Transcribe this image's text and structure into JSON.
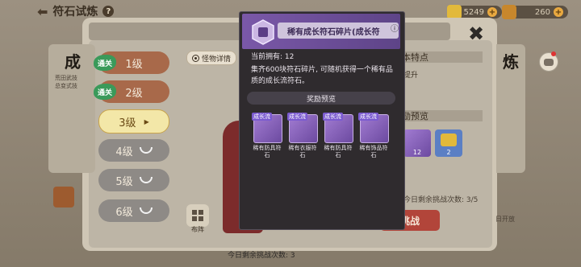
{
  "page": {
    "title": "符石试炼",
    "help_icon": "?",
    "currency1": "5249",
    "currency2": "260",
    "plus": "+"
  },
  "left_card": {
    "title": "成",
    "text": "荒田武技\n总变式技"
  },
  "right_card_title": "炼",
  "levels": [
    {
      "label": "1级",
      "state": "done",
      "badge": "通关"
    },
    {
      "label": "2级",
      "state": "done",
      "badge": "通关"
    },
    {
      "label": "3级",
      "state": "current"
    },
    {
      "label": "4级",
      "state": "locked"
    },
    {
      "label": "5级",
      "state": "locked"
    },
    {
      "label": "6级",
      "state": "locked"
    }
  ],
  "monster_detail_label": "怪物详情",
  "formation_label": "布阵",
  "remaining_bottom": "今日剩余挑战次数: 3",
  "right_panel": {
    "feature_title": "本特点",
    "feature_text": "提升",
    "reward_title": "励预览",
    "reward_counts": [
      "12",
      "2"
    ],
    "remaining": "今日剩余挑战次数: 3/5",
    "challenge_label": "挑战",
    "open_text": "日开放"
  },
  "popup": {
    "title": "稀有成长符石碎片(成长符",
    "owned_label": "当前拥有: 12",
    "description": "集齐600块符石碎片, 可随机获得一个稀有品质的成长流符石。",
    "preview_label": "奖励预览",
    "runes": [
      {
        "tag": "成长流",
        "name": "稀有防具符石"
      },
      {
        "tag": "成长流",
        "name": "稀有衣服符石"
      },
      {
        "tag": "成长流",
        "name": "稀有防具符石"
      },
      {
        "tag": "成长流",
        "name": "稀有饰品符石"
      }
    ]
  },
  "colors": {
    "popup_bg": "#2f2b2e",
    "popup_header": "#7a58a8",
    "challenge": "#b2453a",
    "pass_badge": "#3a9a5a"
  }
}
